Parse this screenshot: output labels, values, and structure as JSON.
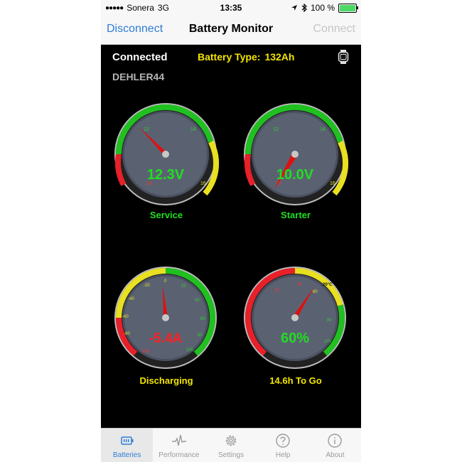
{
  "status_bar": {
    "signal": "●●●●●",
    "carrier": "Sonera",
    "network": "3G",
    "time": "13:35",
    "battery_percent": "100 %",
    "location_icon": "location-arrow-icon",
    "bluetooth_icon": "bluetooth-icon"
  },
  "nav": {
    "left": "Disconnect",
    "title": "Battery Monitor",
    "right": "Connect"
  },
  "info": {
    "status": "Connected",
    "battery_type_label": "Battery Type:",
    "battery_type_value": "132Ah",
    "device": "DEHLER44",
    "watch_icon": "watch-icon"
  },
  "gauges": [
    {
      "id": "service",
      "value_text": "12.3V",
      "label": "Service",
      "ticks": [
        "10",
        "12",
        "14",
        "16"
      ],
      "value_color": "#22dd22",
      "label_color": "#22dd22"
    },
    {
      "id": "starter",
      "value_text": "10.0V",
      "label": "Starter",
      "ticks": [
        "10",
        "12",
        "14",
        "16"
      ],
      "value_color": "#22dd22",
      "label_color": "#22dd22"
    },
    {
      "id": "discharging",
      "value_text": "-5.4A",
      "label": "Discharging",
      "ticks": [
        "-100",
        "-80",
        "-60",
        "-40",
        "-20",
        "0",
        "20",
        "40",
        "60",
        "80",
        "100"
      ],
      "value_color": "#ff2020",
      "label_color": "#f3e500"
    },
    {
      "id": "charge",
      "value_text": "60%",
      "label": "14.6h To Go",
      "ticks": [
        "20",
        "40",
        "60",
        "80",
        "100",
        "20°C"
      ],
      "value_color": "#22dd22",
      "label_color": "#f3e500"
    }
  ],
  "tabs": [
    {
      "label": "Batteries",
      "icon": "battery-icon",
      "active": true
    },
    {
      "label": "Performance",
      "icon": "pulse-icon",
      "active": false
    },
    {
      "label": "Settings",
      "icon": "gear-icon",
      "active": false
    },
    {
      "label": "Help",
      "icon": "help-icon",
      "active": false
    },
    {
      "label": "About",
      "icon": "info-icon",
      "active": false
    }
  ],
  "colors": {
    "accent": "#2d7ed8",
    "green": "#22dd22",
    "yellow": "#f3e500",
    "red": "#ff2020"
  }
}
